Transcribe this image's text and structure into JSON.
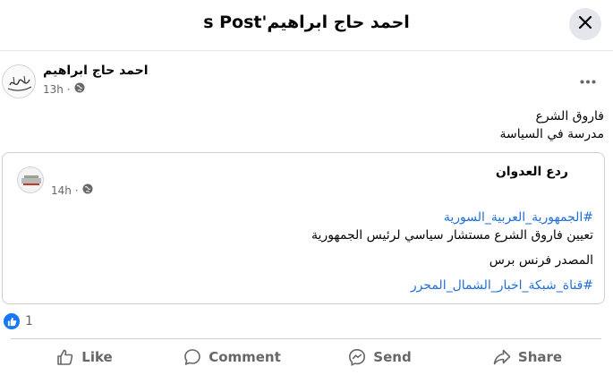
{
  "header": {
    "title": "s Post'احمد حاج ابراهيم"
  },
  "post": {
    "author": "احمد حاج ابراهيم",
    "time": "13h",
    "text_lines": [
      "فاروق الشرع",
      "مدرسة في السياسة"
    ]
  },
  "shared_post": {
    "author": "ردع العدوان",
    "time": "14h",
    "hashtag_1": "#الجمهورية_العربية_السورية",
    "line_1": "تعيين فاروق الشرع مستشار سياسي لرئيس الجمهورية",
    "line_2": "المصدر فرنس برس",
    "hashtag_2": "#قناة_شبكة_اخبار_الشمال_المحرر"
  },
  "reactions": {
    "count": "1"
  },
  "actions": {
    "like": "Like",
    "comment": "Comment",
    "send": "Send",
    "share": "Share"
  },
  "colors": {
    "accent": "#1877f2",
    "hashtag": "#216fdb",
    "muted": "#65676b"
  },
  "icons": {
    "close": "close-icon",
    "more": "more-icon",
    "globe": "globe-icon",
    "like": "thumbs-up-icon",
    "comment": "comment-icon",
    "send": "messenger-icon",
    "share": "share-icon"
  }
}
